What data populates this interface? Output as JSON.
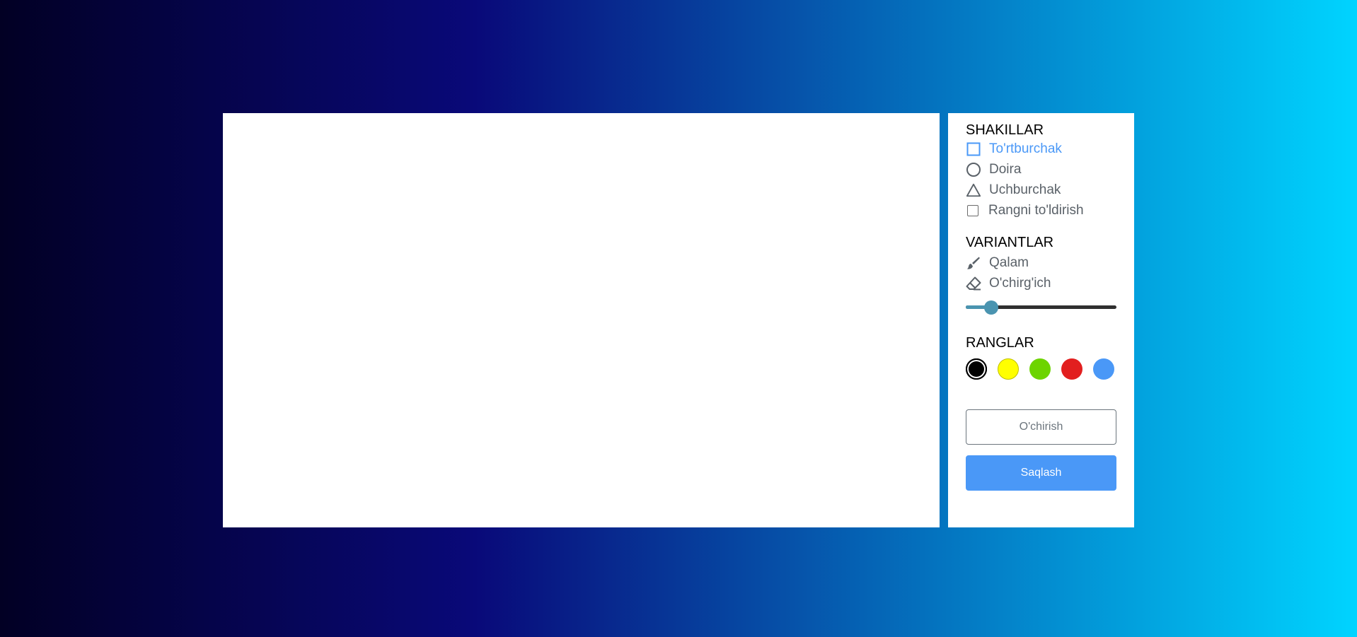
{
  "shapes": {
    "title": "SHAKILLAR",
    "items": [
      {
        "label": "To'rtburchak",
        "icon": "square-icon",
        "active": true
      },
      {
        "label": "Doira",
        "icon": "circle-icon",
        "active": false
      },
      {
        "label": "Uchburchak",
        "icon": "triangle-icon",
        "active": false
      }
    ],
    "fill_label": "Rangni to'ldirish"
  },
  "options": {
    "title": "VARIANTLAR",
    "items": [
      {
        "label": "Qalam",
        "icon": "brush-icon",
        "active": false
      },
      {
        "label": "O'chirg'ich",
        "icon": "eraser-icon",
        "active": false
      }
    ],
    "brush_size": 0.17
  },
  "colors": {
    "title": "RANGLAR",
    "swatches": [
      {
        "name": "black",
        "hex": "#000000",
        "selected": true
      },
      {
        "name": "yellow",
        "hex": "#ffff00",
        "selected": false
      },
      {
        "name": "green",
        "hex": "#6dd400",
        "selected": false
      },
      {
        "name": "red",
        "hex": "#e21f1f",
        "selected": false
      },
      {
        "name": "blue",
        "hex": "#4a98f7",
        "selected": false
      }
    ]
  },
  "buttons": {
    "clear_label": "O'chirish",
    "save_label": "Saqlash"
  },
  "theme": {
    "accent": "#4a98f7",
    "slider": "#4a94b0"
  }
}
